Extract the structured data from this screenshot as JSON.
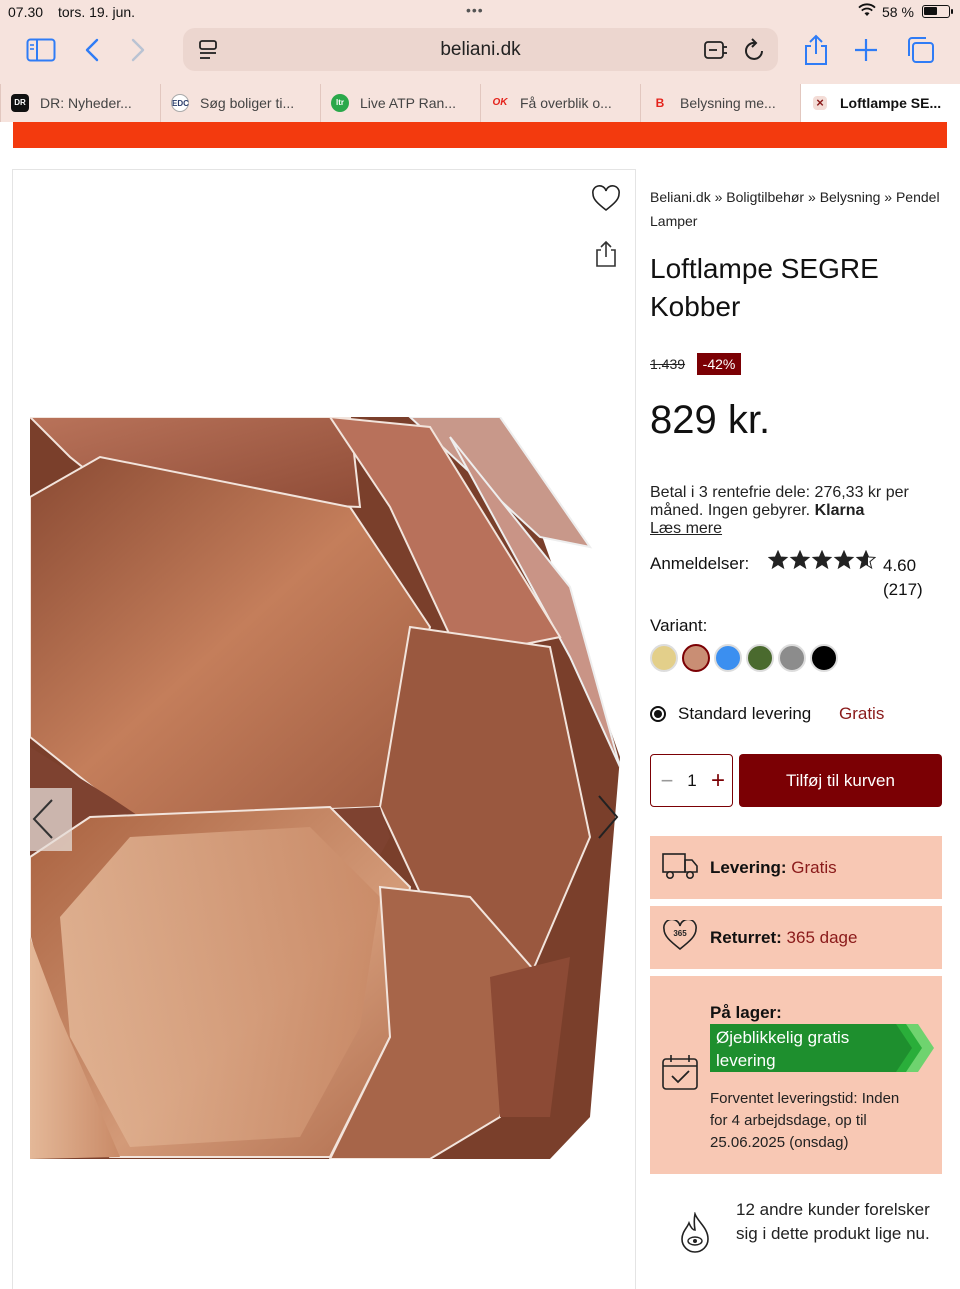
{
  "status_bar": {
    "time": "07.30",
    "date": "tors. 19. jun.",
    "battery": "58 %"
  },
  "toolbar": {
    "url": "beliani.dk",
    "icons": [
      "sidebar-icon",
      "back-icon",
      "forward-icon",
      "page-menu-icon",
      "translate-icon",
      "reload-icon",
      "share-icon",
      "new-tab-icon",
      "tabs-icon"
    ]
  },
  "tabs": [
    {
      "title": "DR: Nyheder...",
      "favicon": "DR",
      "color": "#111111"
    },
    {
      "title": "Søg boliger ti...",
      "favicon": "EDC",
      "color": "#2a3c6b"
    },
    {
      "title": "Live ATP Ran...",
      "favicon": "ltr",
      "color": "#2aa84a"
    },
    {
      "title": "Få overblik o...",
      "favicon": "OK",
      "color": "#e4231b"
    },
    {
      "title": "Belysning me...",
      "favicon": "B",
      "color": "#e4231b"
    },
    {
      "title": "Loftlampe SE...",
      "favicon": "×",
      "color": "#8a1a1a",
      "active": true
    }
  ],
  "product": {
    "breadcrumb": [
      "Beliani.dk",
      "»",
      "Boligtilbehør",
      "»",
      "Belysning",
      "»",
      "Pendel Lamper"
    ],
    "title": "Loftlampe SEGRE Kobber",
    "old_price": "1.439",
    "discount": "-42%",
    "price": "829 kr.",
    "klarna_text": "Betal i 3 rentefrie dele: 276,33 kr per måned. Ingen gebyrer.",
    "klarna_brand": "Klarna",
    "klarna_more": "Læs mere",
    "reviews_label": "Anmeldelser:",
    "rating_value": "4.60",
    "rating_count": "(217)",
    "rating_stars": 4.6,
    "variant_label": "Variant:",
    "variants": [
      {
        "color": "#e3cf8a",
        "selected": false
      },
      {
        "color": "#c98e74",
        "selected": true
      },
      {
        "color": "#3b8ff0",
        "selected": false
      },
      {
        "color": "#4a6a2e",
        "selected": false
      },
      {
        "color": "#8c8c8c",
        "selected": false
      },
      {
        "color": "#000000",
        "selected": false
      }
    ],
    "delivery_option": "Standard levering",
    "delivery_option_price": "Gratis",
    "quantity": "1",
    "add_to_cart": "Tilføj til kurven"
  },
  "info": {
    "delivery_label": "Levering:",
    "delivery_value": "Gratis",
    "return_label": "Returret:",
    "return_value": "365 dage",
    "return_badge": "365",
    "stock_title": "På lager:",
    "stock_flag": "Øjeblikkelig gratis levering",
    "stock_eta": "Forventet leveringstid: Inden for 4 arbejdsdage, op til 25.06.2025 (onsdag)"
  },
  "social_proof": "12 andre kunder forelsker sig i dette produkt lige nu.",
  "colors": {
    "accent": "#7b0004",
    "banner": "#f33a0e",
    "info_bg": "#f8c8b4",
    "stock_green": "#1e8f2e",
    "chrome_bg": "#f6e3dd"
  }
}
